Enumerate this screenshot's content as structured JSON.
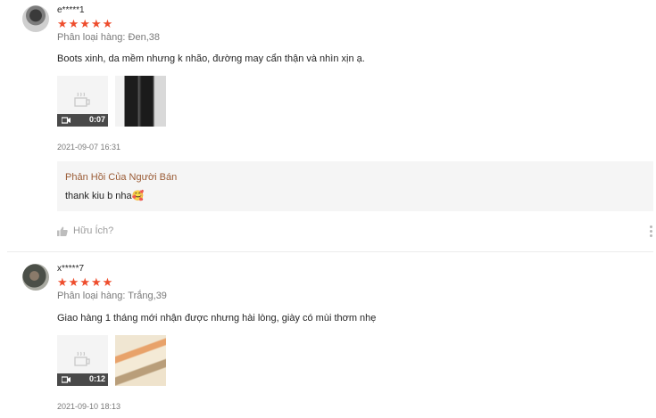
{
  "reviews": [
    {
      "username": "e*****1",
      "stars": [
        "★",
        "★",
        "★",
        "★",
        "★"
      ],
      "variation": "Phân loại hàng: Đen,38",
      "content": "Boots xinh, da mềm nhưng k nhão, đường may cẩn thận và nhìn xịn ạ.",
      "video_duration": "0:07",
      "datetime": "2021-09-07 16:31",
      "seller_reply_title": "Phản Hồi Của Người Bán",
      "seller_reply_text": "thank kiu b nha🥰",
      "helpful_label": "Hữu Ích?"
    },
    {
      "username": "x*****7",
      "stars": [
        "★",
        "★",
        "★",
        "★",
        "★"
      ],
      "variation": "Phân loại hàng: Trắng,39",
      "content": "Giao hàng 1 tháng mới nhận được nhưng hài lòng, giày có mùi thơm nhẹ",
      "video_duration": "0:12",
      "datetime": "2021-09-10 18:13"
    }
  ],
  "colors": {
    "star": "#ee4d2d",
    "seller_title": "#9a5b35",
    "reply_bg": "#f5f5f5"
  },
  "icons": {
    "video": "video-camera-icon",
    "cam_placeholder": "camera-placeholder-icon",
    "helpful": "thumbs-up-icon",
    "more": "more-vertical-icon"
  }
}
